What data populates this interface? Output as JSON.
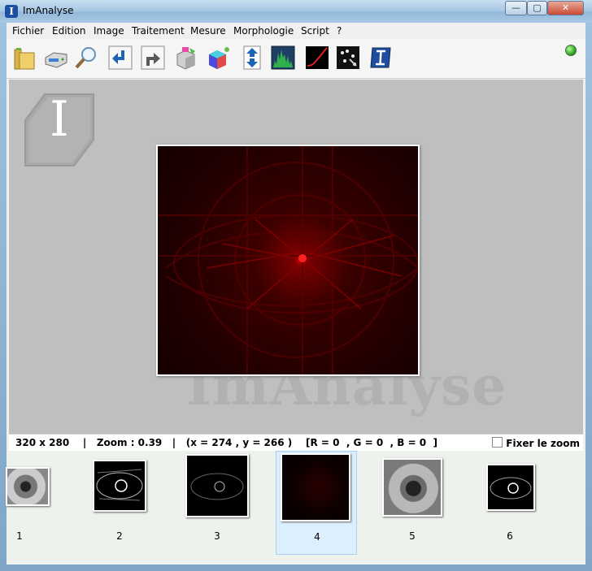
{
  "window": {
    "title": "ImAnalyse",
    "app_icon_glyph": "I",
    "buttons": {
      "minimize": "—",
      "maximize": "▢",
      "close": "✕"
    }
  },
  "menu": [
    "Fichier",
    "Edition",
    "Image",
    "Traitement",
    "Mesure",
    "Morphologie",
    "Script",
    "?"
  ],
  "toolbar": {
    "tools": [
      {
        "name": "open-folder-icon"
      },
      {
        "name": "save-disk-icon"
      },
      {
        "name": "zoom-magnifier-icon"
      },
      {
        "name": "undo-arrow-icon"
      },
      {
        "name": "redo-arrow-icon"
      },
      {
        "name": "color-cube-icon"
      },
      {
        "name": "rgb-cube-icon"
      },
      {
        "name": "up-down-arrows-icon"
      },
      {
        "name": "histogram-icon"
      },
      {
        "name": "curve-graph-icon"
      },
      {
        "name": "scatter-points-icon"
      },
      {
        "name": "imanalyse-logo-icon"
      }
    ],
    "status_color": "#2fa81f"
  },
  "workspace": {
    "watermark": "ImAnalyse",
    "badge_glyph": "I"
  },
  "status": {
    "text": "320 x 280    |   Zoom : 0.39   |   (x = 274 , y = 266 )    [R = 0  , G = 0  , B = 0  ]",
    "fix_zoom_label": "Fixer le zoom"
  },
  "thumbnails": [
    {
      "label": "1",
      "kind": "eye-gray"
    },
    {
      "label": "2",
      "kind": "eye-edges"
    },
    {
      "label": "3",
      "kind": "eye-edges-faint"
    },
    {
      "label": "4",
      "kind": "spectrum-dark",
      "selected": true
    },
    {
      "label": "5",
      "kind": "eye-gray"
    },
    {
      "label": "6",
      "kind": "eye-edges"
    }
  ]
}
